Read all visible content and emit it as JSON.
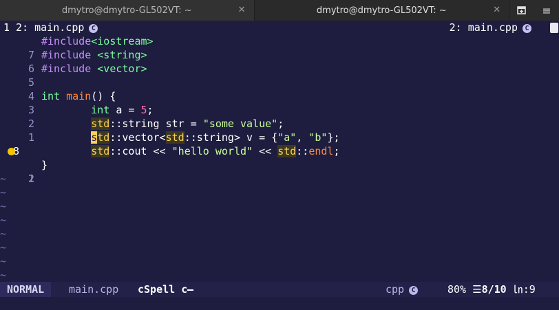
{
  "window": {
    "tabs": [
      {
        "title": "dmytro@dmytro-GL502VT: ~",
        "active": false
      },
      {
        "title": "dmytro@dmytro-GL502VT: ~",
        "active": true
      }
    ],
    "close_glyph": "✕",
    "menu_glyph": "≡"
  },
  "tabline": {
    "left": "1 2: main.cpp",
    "left_icon": "C",
    "right": "2: main.cpp",
    "right_icon": "C"
  },
  "editor": {
    "lines": [
      {
        "num": "7",
        "current": false,
        "code": "include_iostream"
      },
      {
        "num": "6",
        "current": false,
        "code": "include_string"
      },
      {
        "num": "5",
        "current": false,
        "code": "include_vector"
      },
      {
        "num": "4",
        "current": false,
        "code": "blank"
      },
      {
        "num": "3",
        "current": false,
        "code": "main"
      },
      {
        "num": "2",
        "current": false,
        "code": "int_a"
      },
      {
        "num": "1",
        "current": false,
        "code": "string_str"
      },
      {
        "num": "8",
        "current": true,
        "code": "vector_v"
      },
      {
        "num": "1",
        "current": false,
        "code": "cout",
        "sign": "warning-dot"
      },
      {
        "num": "2",
        "current": false,
        "code": "close_brace"
      }
    ],
    "tilde": "~",
    "tilde_count": 8,
    "code_text": {
      "inc1": "#include",
      "lib1": "<iostream>",
      "inc2": "#include ",
      "lib2": "<string>",
      "inc3": "#include ",
      "lib3": "<vector>",
      "int_kw": "int",
      "main_fn": "main",
      "main_rest": "() {",
      "int_kw2": "int",
      "a_rest": " a = ",
      "five": "5",
      "semi": ";",
      "std1": "std",
      "string_rest": "::string str = ",
      "some_value": "\"some value\"",
      "semi2": ";",
      "cursor_s": "s",
      "td": "td",
      "vector_pre": "::vector<",
      "std3": "std",
      "string2": "::string",
      "vector_rest": "> v = {",
      "a_str": "\"a\"",
      "comma": ", ",
      "b_str": "\"b\"",
      "vec_end": "};",
      "std4": "std",
      "cout_rest": "::cout << ",
      "hello": "\"hello world\"",
      "shift": " << ",
      "std5": "std",
      "endl_sep": "::",
      "endl": "endl",
      "semi3": ";",
      "brace": "}"
    }
  },
  "statusline": {
    "mode": "NORMAL",
    "file": "main.cpp",
    "cspell": "cSpell c",
    "filetype": "cpp",
    "filetype_icon": "C",
    "percent": "80%",
    "lines_icon": "☰",
    "position": "8/10",
    "col_icon": "㏑",
    "col": ":9"
  },
  "colors": {
    "background": "#1e1d3f",
    "warning": "#f5c400",
    "namespace": "#ffd15a"
  }
}
